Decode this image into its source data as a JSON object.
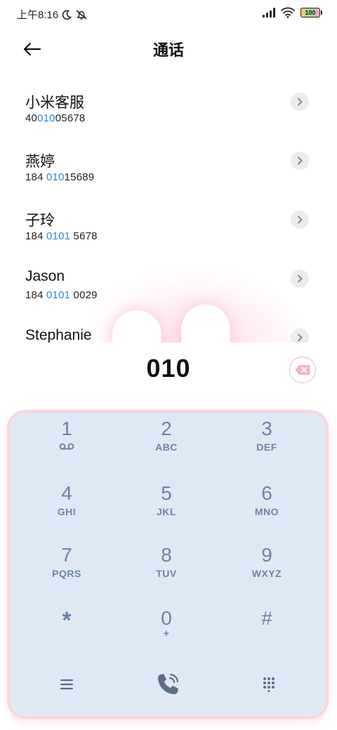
{
  "status_bar": {
    "time": "上午8:16",
    "battery": "100"
  },
  "header": {
    "title": "通话"
  },
  "contacts": [
    {
      "name": "小米客服",
      "num_pre": "40",
      "num_hl": "010",
      "num_post": "05678"
    },
    {
      "name": "燕婷",
      "num_pre": "184 ",
      "num_hl": "010",
      "num_post": "15689"
    },
    {
      "name": "子玲",
      "num_pre": "184 ",
      "num_hl": "0101",
      "num_post": " 5678"
    },
    {
      "name": "Jason",
      "num_pre": "184 ",
      "num_hl": "0101",
      "num_post": " 0029"
    },
    {
      "name": "Stephanie",
      "num_pre": "",
      "num_hl": "",
      "num_post": ""
    }
  ],
  "dialed_number": "010",
  "keypad": [
    {
      "digit": "1",
      "letters": ""
    },
    {
      "digit": "2",
      "letters": "ABC"
    },
    {
      "digit": "3",
      "letters": "DEF"
    },
    {
      "digit": "4",
      "letters": "GHI"
    },
    {
      "digit": "5",
      "letters": "JKL"
    },
    {
      "digit": "6",
      "letters": "MNO"
    },
    {
      "digit": "7",
      "letters": "PQRS"
    },
    {
      "digit": "8",
      "letters": "TUV"
    },
    {
      "digit": "9",
      "letters": "WXYZ"
    },
    {
      "digit": "*",
      "letters": ""
    },
    {
      "digit": "0",
      "letters": "+"
    },
    {
      "digit": "#",
      "letters": ""
    }
  ],
  "icons": {
    "back": "arrow-left-icon",
    "chevron": "chevron-right-icon",
    "backspace": "backspace-icon",
    "voicemail": "voicemail-icon",
    "menu": "menu-icon",
    "call": "call-icon",
    "dialpad": "dialpad-icon"
  },
  "colors": {
    "accent": "#2a8ad4",
    "keypad_bg": "#dfe9f6",
    "key_text": "#6b84a4",
    "pad_border": "#f8d6dd"
  }
}
